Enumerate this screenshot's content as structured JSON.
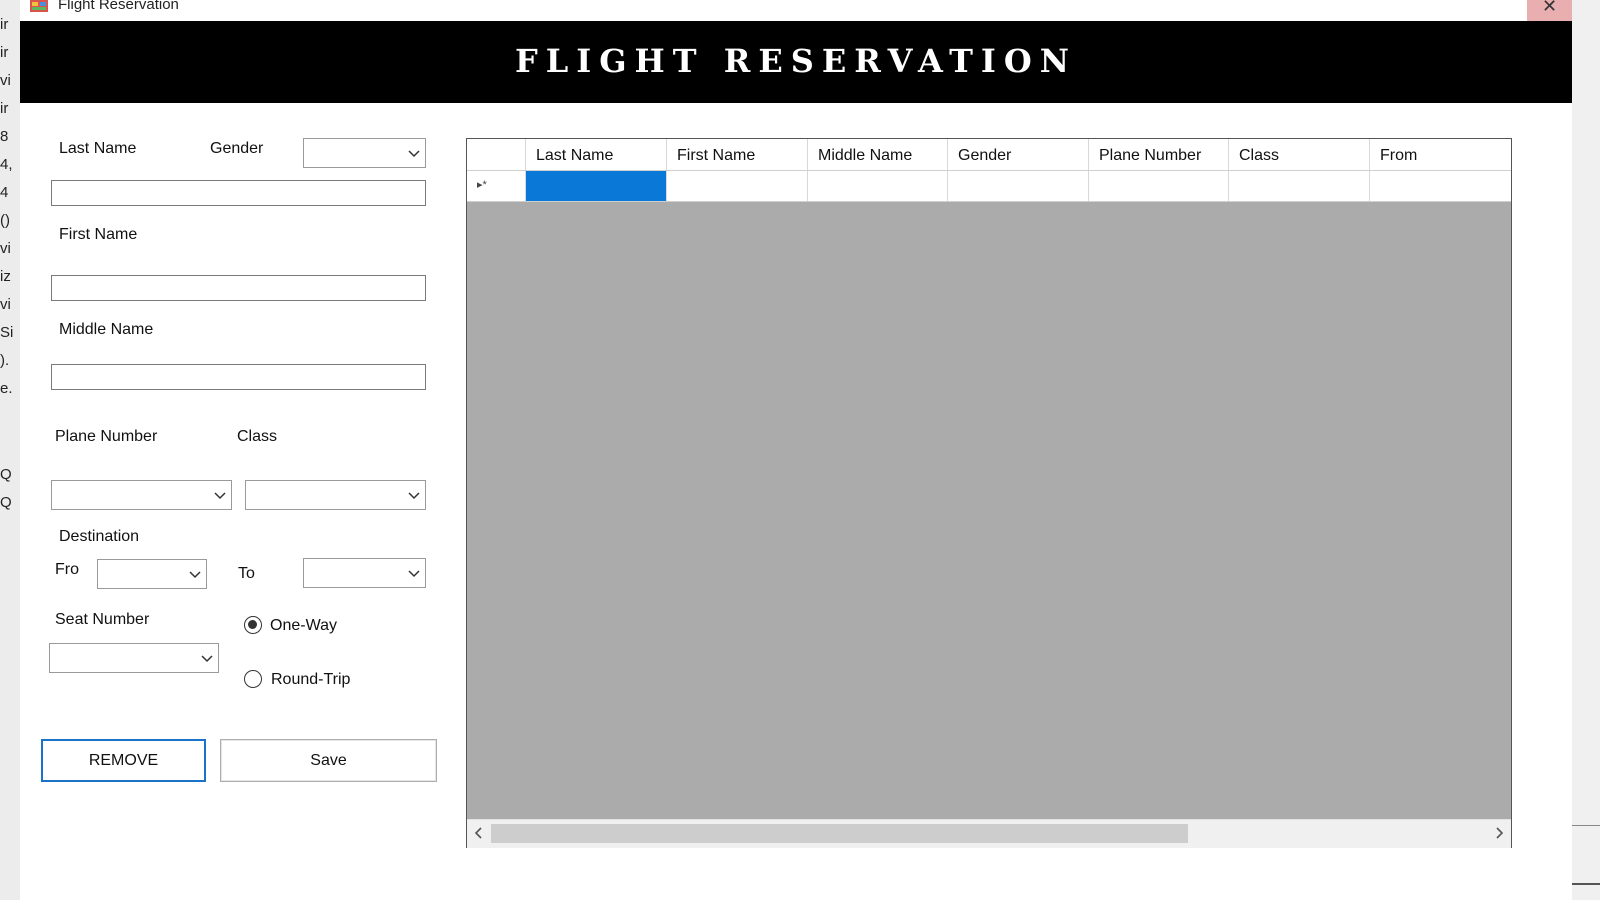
{
  "window": {
    "title": "Flight Reservation",
    "close_glyph": "✕"
  },
  "banner": {
    "title": "FLIGHT RESERVATION"
  },
  "background_text": [
    "ir",
    "ir",
    "vi",
    "ir",
    "8",
    "4,",
    "4",
    "()",
    "vi",
    "iz",
    "vi",
    "Si",
    ").",
    "e.",
    "Q",
    "Q"
  ],
  "form": {
    "last_name_label": "Last Name",
    "gender_label": "Gender",
    "first_name_label": "First Name",
    "middle_name_label": "Middle Name",
    "plane_number_label": "Plane Number",
    "class_label": "Class",
    "destination_label": "Destination",
    "from_label": "Fro",
    "to_label": "To",
    "seat_number_label": "Seat Number",
    "one_way_label": "One-Way",
    "round_trip_label": "Round-Trip",
    "trip_type_selected": "One-Way",
    "last_name_value": "",
    "first_name_value": "",
    "middle_name_value": "",
    "gender_value": "",
    "plane_number_value": "",
    "class_value": "",
    "from_value": "",
    "to_value": "",
    "seat_number_value": ""
  },
  "buttons": {
    "remove_label": "REMOVE",
    "save_label": "Save"
  },
  "grid": {
    "columns": [
      "Last Name",
      "First Name",
      "Middle Name",
      "Gender",
      "Plane Number",
      "Class",
      "From"
    ],
    "new_row_indicator": "▸*",
    "selected_cell_color": "#0a78d7"
  },
  "colors": {
    "banner_bg": "#000000",
    "banner_text": "#ffffff",
    "grid_bg": "#ababab",
    "remove_border": "#1a73c8",
    "close_bg": "#e8aeb0"
  }
}
